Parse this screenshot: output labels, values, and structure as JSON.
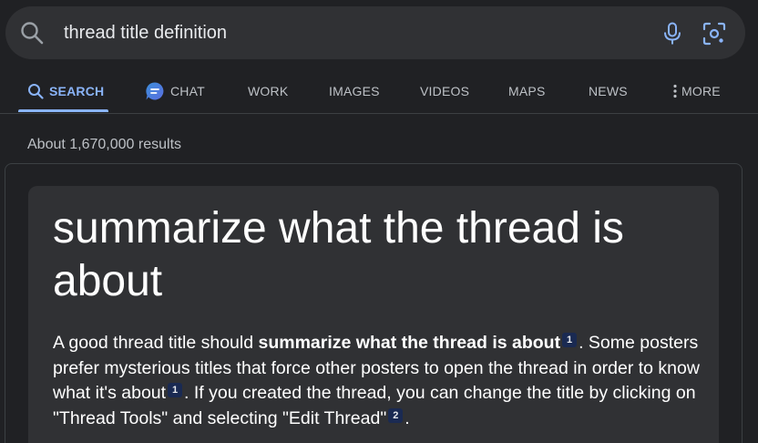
{
  "search": {
    "query": "thread title definition",
    "search_icon": "search-icon",
    "mic_icon": "microphone-icon",
    "camera_icon": "camera-lens-icon"
  },
  "tabs": [
    {
      "label": "SEARCH",
      "icon": "search-icon",
      "active": true
    },
    {
      "label": "CHAT",
      "icon": "chat-bubble-icon",
      "active": false
    },
    {
      "label": "WORK",
      "active": false
    },
    {
      "label": "IMAGES",
      "active": false
    },
    {
      "label": "VIDEOS",
      "active": false
    },
    {
      "label": "MAPS",
      "active": false
    },
    {
      "label": "NEWS",
      "active": false
    },
    {
      "label": "MORE",
      "icon": "more-vertical-icon",
      "active": false
    }
  ],
  "results": {
    "stats": "About 1,670,000 results"
  },
  "answer": {
    "title": "summarize what the thread is about",
    "snippet_part1": "A good thread title should ",
    "snippet_bold": "summarize what the thread is about",
    "cite1": "1",
    "snippet_part2": ". Some posters prefer mysterious titles that force other posters to open the thread in order to know what it's about",
    "cite2": "1",
    "snippet_part3": ". If you created the thread, you can change the title by clicking on \"Thread Tools\" and selecting \"Edit Thread\"",
    "cite3": "2",
    "snippet_part4": "."
  },
  "colors": {
    "background": "#202124",
    "surface": "#303134",
    "accent": "#8ab4f8",
    "text": "#e8eaed",
    "muted": "#bdc1c6",
    "citation_bg": "#1a2a52"
  }
}
